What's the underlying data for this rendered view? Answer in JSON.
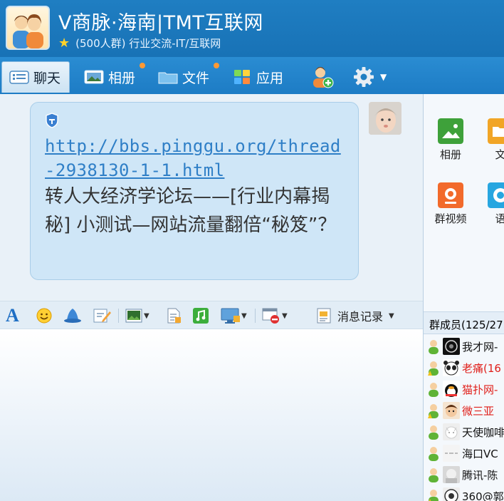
{
  "header": {
    "title": "V商脉·海南|TMT互联网",
    "subtitle": "(500人群) 行业交流-IT/互联网"
  },
  "tabs": [
    {
      "label": "聊天",
      "icon": "chat-icon",
      "active": true
    },
    {
      "label": "相册",
      "icon": "album-icon",
      "has_dot": true
    },
    {
      "label": "文件",
      "icon": "folder-icon",
      "has_dot": true
    },
    {
      "label": "应用",
      "icon": "apps-icon"
    }
  ],
  "message": {
    "link": "http://bbs.pinggu.org/thread-2938130-1-1.html",
    "text": "转人大经济学论坛——[行业内幕揭秘] 小测试—网站流量翻倍“秘笈”？"
  },
  "toolbar": {
    "history_label": "消息记录"
  },
  "right_panel": {
    "apps": [
      {
        "label": "相册",
        "color": "#3ea13a"
      },
      {
        "label": "文",
        "color": "#f1a526"
      },
      {
        "label": "群视频",
        "color": "#f26a2b"
      },
      {
        "label": "语",
        "color": "#27a6e0"
      }
    ],
    "members_header": "群成员(125/27",
    "members": [
      {
        "name": "我才网-",
        "red": false
      },
      {
        "name": "老痛(16",
        "red": true
      },
      {
        "name": "猫扑网-",
        "red": true
      },
      {
        "name": "微三亚",
        "red": true
      },
      {
        "name": "天使咖啡",
        "red": false
      },
      {
        "name": "海口VC",
        "red": false
      },
      {
        "name": "腾讯-陈",
        "red": false
      },
      {
        "name": "360@郭",
        "red": false
      }
    ]
  },
  "colors": {
    "header_bg": "#1f7ec2",
    "bubble_bg": "#cfe6f7",
    "link": "#2f7fc7",
    "red_name": "#e0201b"
  }
}
